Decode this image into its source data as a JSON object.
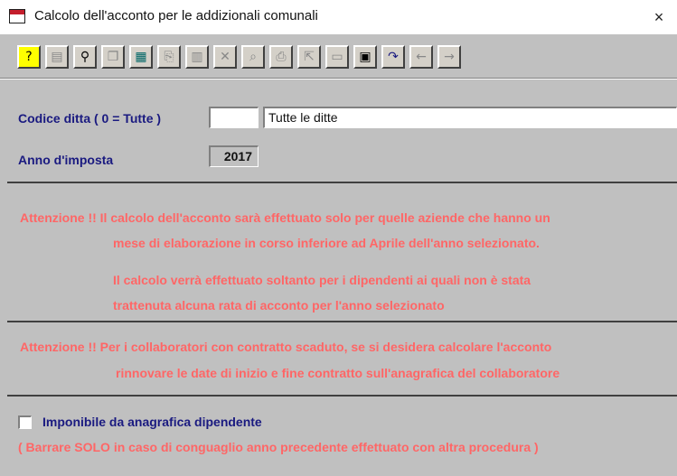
{
  "window": {
    "title": "Calcolo dell'acconto per le addizionali comunali",
    "close_glyph": "×"
  },
  "toolbar": {
    "buttons": [
      {
        "icon": "help-icon",
        "glyph": "?"
      },
      {
        "icon": "properties-icon",
        "glyph": "▤"
      },
      {
        "icon": "binoculars-icon",
        "glyph": "⚲"
      },
      {
        "icon": "copy-records-icon",
        "glyph": "❐"
      },
      {
        "icon": "calculator-icon",
        "glyph": "▦"
      },
      {
        "icon": "copy-icon",
        "glyph": "⎘"
      },
      {
        "icon": "grid-icon",
        "glyph": "▥"
      },
      {
        "icon": "delete-icon",
        "glyph": "✕"
      },
      {
        "icon": "preview-icon",
        "glyph": "⌕"
      },
      {
        "icon": "print-icon",
        "glyph": "⎙"
      },
      {
        "icon": "export-icon",
        "glyph": "⇱"
      },
      {
        "icon": "note-icon",
        "glyph": "▭"
      },
      {
        "icon": "save-icon",
        "glyph": "▣"
      },
      {
        "icon": "redo-icon",
        "glyph": "↷"
      },
      {
        "icon": "arrow-left-icon",
        "glyph": "←"
      },
      {
        "icon": "arrow-right-icon",
        "glyph": "→"
      }
    ]
  },
  "form": {
    "codice_ditta_label": "Codice ditta ( 0 = Tutte )",
    "codice_ditta_value": "",
    "ditta_description": "Tutte le ditte",
    "anno_label": "Anno d'imposta",
    "anno_value": "2017"
  },
  "warnings": {
    "line1": "Attenzione !! Il calcolo dell'acconto sarà effettuato solo per quelle aziende che hanno un",
    "line2": "mese di elaborazione in corso inferiore ad Aprile dell'anno selezionato.",
    "line3": "Il calcolo verrà effettuato soltanto per i dipendenti ai quali non è stata",
    "line4": "trattenuta alcuna rata di acconto per l'anno selezionato",
    "line5": "Attenzione !! Per i collaboratori con contratto scaduto, se si desidera calcolare l'acconto",
    "line6": "rinnovare le date di inizio e fine contratto sull'anagrafica del collaboratore"
  },
  "checkbox": {
    "label": "Imponibile da anagrafica dipendente",
    "checked": false,
    "note": "( Barrare SOLO in caso di conguaglio anno precedente effettuato con altra procedura )"
  },
  "colors": {
    "warning": "#ff6666",
    "label": "#1a1a80",
    "background": "#c0c0c0"
  }
}
